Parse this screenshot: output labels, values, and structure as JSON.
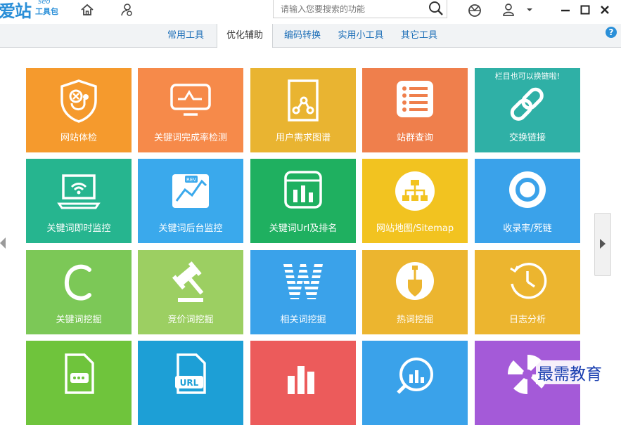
{
  "app": {
    "logo_main": "爱站",
    "logo_sub": "工具包",
    "logo_seo": "seo"
  },
  "search": {
    "placeholder": "请输入您要搜索的功能"
  },
  "tabs": [
    {
      "label": "常用工具",
      "active": false
    },
    {
      "label": "优化辅助",
      "active": true
    },
    {
      "label": "编码转换",
      "active": false
    },
    {
      "label": "实用小工具",
      "active": false
    },
    {
      "label": "其它工具",
      "active": false
    }
  ],
  "help_label": "?",
  "tiles": [
    {
      "label": "网站体检",
      "color": "#f59a2d",
      "icon": "shield-doctor-icon"
    },
    {
      "label": "关键词完成率检测",
      "color": "#f68a4a",
      "icon": "monitor-chart-icon"
    },
    {
      "label": "用户需求图谱",
      "color": "#e9b431",
      "icon": "document-graph-icon"
    },
    {
      "label": "站群查询",
      "color": "#ef7f4c",
      "icon": "list-icon"
    },
    {
      "label": "交换链接",
      "color": "#2fb0a6",
      "icon": "chain-link-icon",
      "note": "栏目也可以换链啦!"
    },
    {
      "label": "关键词即时监控",
      "color": "#26b58f",
      "icon": "laptop-wifi-icon"
    },
    {
      "label": "关键词后台监控",
      "color": "#3aa9ec",
      "icon": "trend-map-icon"
    },
    {
      "label": "关键词Url及排名",
      "color": "#1fb060",
      "icon": "bar-chart-card-icon"
    },
    {
      "label": "网站地图/Sitemap",
      "color": "#f2c320",
      "icon": "sitemap-icon"
    },
    {
      "label": "收录率/死链",
      "color": "#3aa2ea",
      "icon": "ring-icon"
    },
    {
      "label": "关键词挖掘",
      "color": "#7cc857",
      "icon": "letter-c-icon"
    },
    {
      "label": "竞价词挖掘",
      "color": "#9ccf62",
      "icon": "gavel-icon"
    },
    {
      "label": "相关词挖掘",
      "color": "#3aa2ea",
      "icon": "striped-w-icon"
    },
    {
      "label": "热词挖掘",
      "color": "#ecb52f",
      "icon": "shovel-icon"
    },
    {
      "label": "日志分析",
      "color": "#ecb52f",
      "icon": "clock-icon"
    },
    {
      "label": "",
      "color": "#6fc43c",
      "icon": "file-dots-icon"
    },
    {
      "label": "",
      "color": "#1d9fd6",
      "icon": "url-file-icon"
    },
    {
      "label": "",
      "color": "#ec5b5b",
      "icon": "bar-chart-icon"
    },
    {
      "label": "",
      "color": "#3aa2ea",
      "icon": "magnifier-chart-icon"
    },
    {
      "label": "",
      "color": "#a45ad8",
      "icon": "pinwheel-icon"
    }
  ],
  "watermark": "最需教育"
}
